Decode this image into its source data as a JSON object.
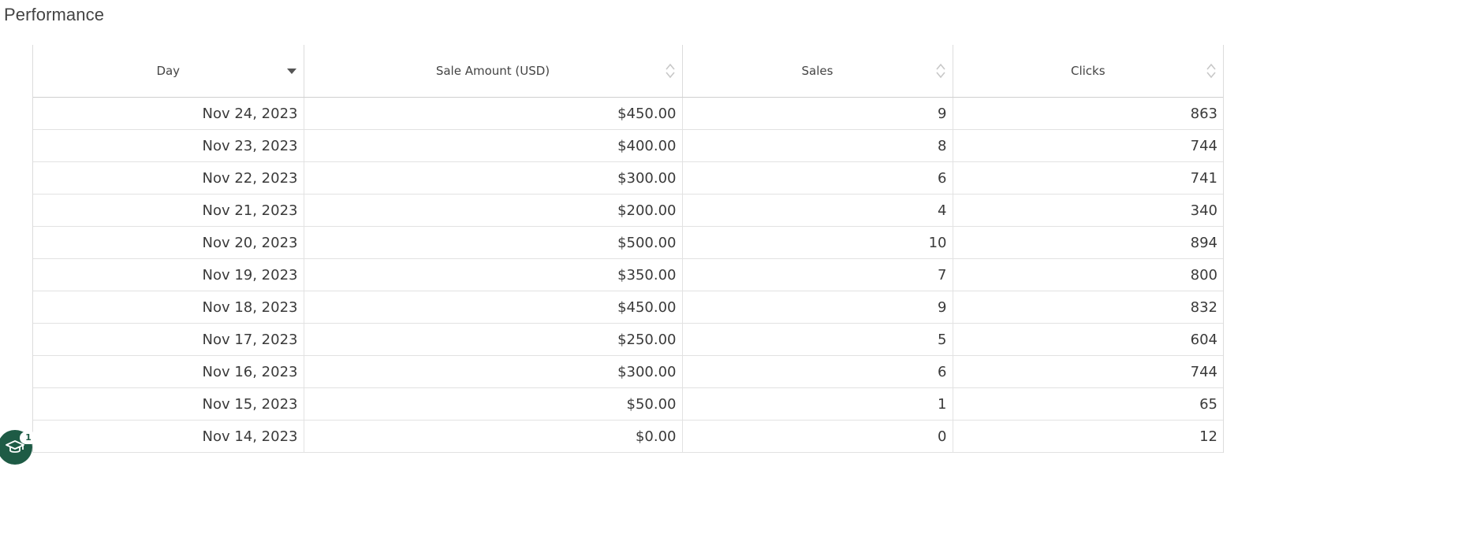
{
  "page": {
    "title": "Performance"
  },
  "table": {
    "columns": [
      {
        "label": "Day",
        "sort": "desc"
      },
      {
        "label": "Sale Amount (USD)",
        "sort": "none"
      },
      {
        "label": "Sales",
        "sort": "none"
      },
      {
        "label": "Clicks",
        "sort": "none"
      }
    ],
    "rows": [
      [
        "Nov 24, 2023",
        "$450.00",
        "9",
        "863"
      ],
      [
        "Nov 23, 2023",
        "$400.00",
        "8",
        "744"
      ],
      [
        "Nov 22, 2023",
        "$300.00",
        "6",
        "741"
      ],
      [
        "Nov 21, 2023",
        "$200.00",
        "4",
        "340"
      ],
      [
        "Nov 20, 2023",
        "$500.00",
        "10",
        "894"
      ],
      [
        "Nov 19, 2023",
        "$350.00",
        "7",
        "800"
      ],
      [
        "Nov 18, 2023",
        "$450.00",
        "9",
        "832"
      ],
      [
        "Nov 17, 2023",
        "$250.00",
        "5",
        "604"
      ],
      [
        "Nov 16, 2023",
        "$300.00",
        "6",
        "744"
      ],
      [
        "Nov 15, 2023",
        "$50.00",
        "1",
        "65"
      ],
      [
        "Nov 14, 2023",
        "$0.00",
        "0",
        "12"
      ]
    ]
  },
  "help_widget": {
    "icon": "graduation-cap-icon",
    "count": "1",
    "color": "#1e5b45"
  },
  "colors": {
    "header_text": "#444444",
    "cell_text": "#3a3a3a",
    "grid_line": "#e2e2e2",
    "sort_active": "#555555",
    "sort_inactive": "#c8c8c8"
  }
}
